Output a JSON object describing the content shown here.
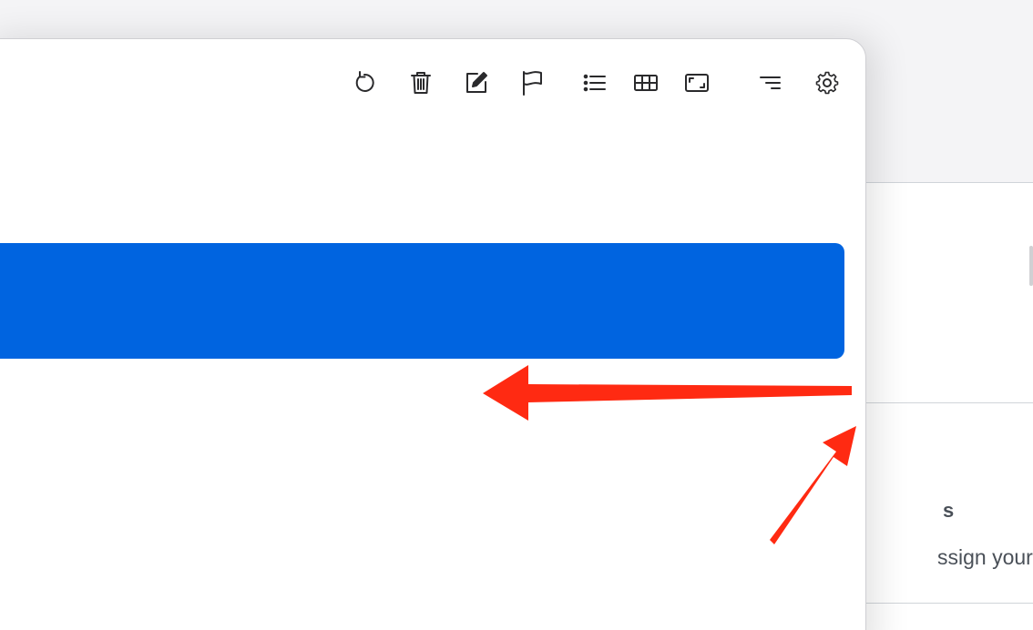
{
  "toolbar": {
    "icons": [
      "refresh-icon",
      "trash-icon",
      "edit-icon",
      "flag-icon",
      "list-icon",
      "grid-icon",
      "fullscreen-icon",
      "sort-icon",
      "gear-icon"
    ]
  },
  "background_panel": {
    "heading_fragment": "s",
    "link_fragment": "ssign yourself"
  },
  "colors": {
    "highlight": "#0064e0",
    "annotation_arrow": "#ff2a12"
  }
}
